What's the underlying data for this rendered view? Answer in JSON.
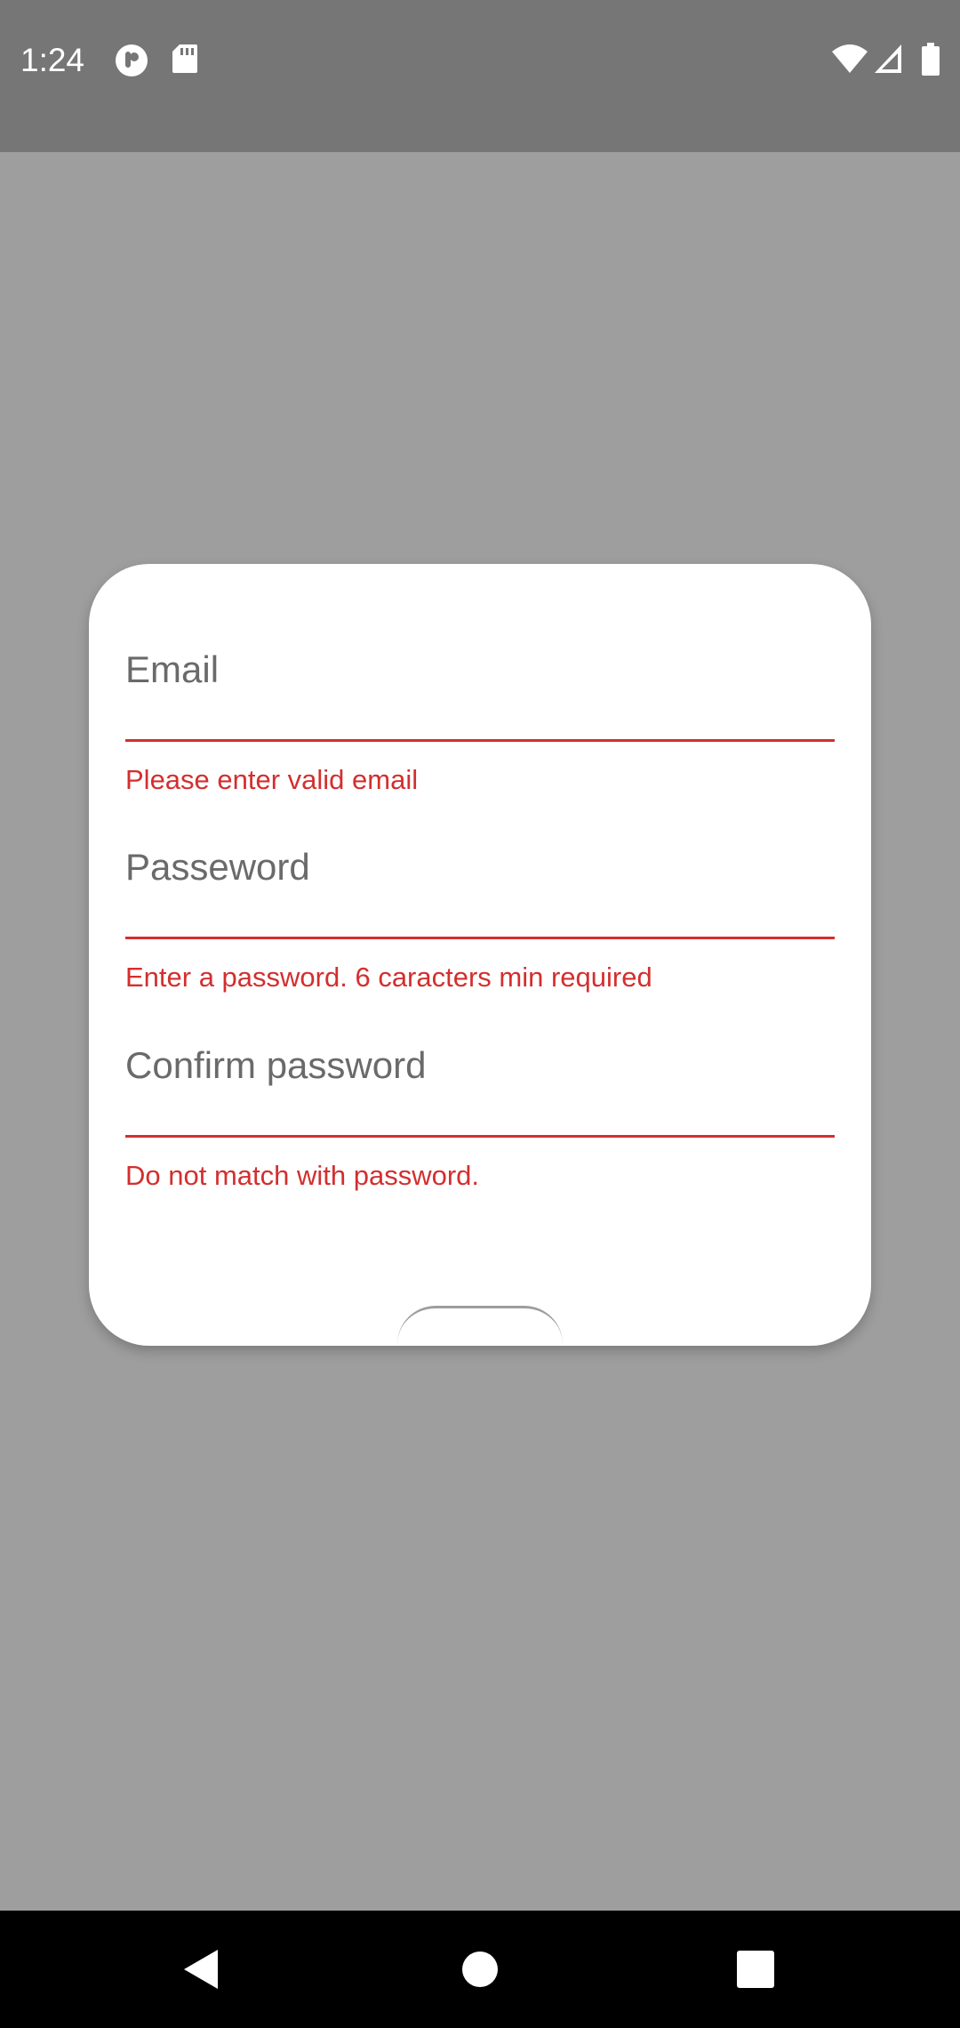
{
  "status_bar": {
    "time": "1:24",
    "left_icons": [
      "circle-badge-icon",
      "sd-card-icon"
    ],
    "right_icons": [
      "wifi-icon",
      "signal-icon",
      "battery-icon"
    ]
  },
  "dialog": {
    "fields": [
      {
        "label": "Email",
        "error": "Please enter valid email"
      },
      {
        "label": "Passeword",
        "error": "Enter a password. 6 caracters min required"
      },
      {
        "label": "Confirm password",
        "error": "Do not match with password."
      }
    ]
  },
  "nav_bar": {
    "buttons": [
      "back-icon",
      "home-icon",
      "recents-icon"
    ]
  },
  "colors": {
    "scrim": "#9e9e9e",
    "status_bar": "#767676",
    "error": "#d32f2f",
    "label": "#6a6a6a",
    "dialog_bg": "#ffffff",
    "nav_bar": "#000000"
  }
}
